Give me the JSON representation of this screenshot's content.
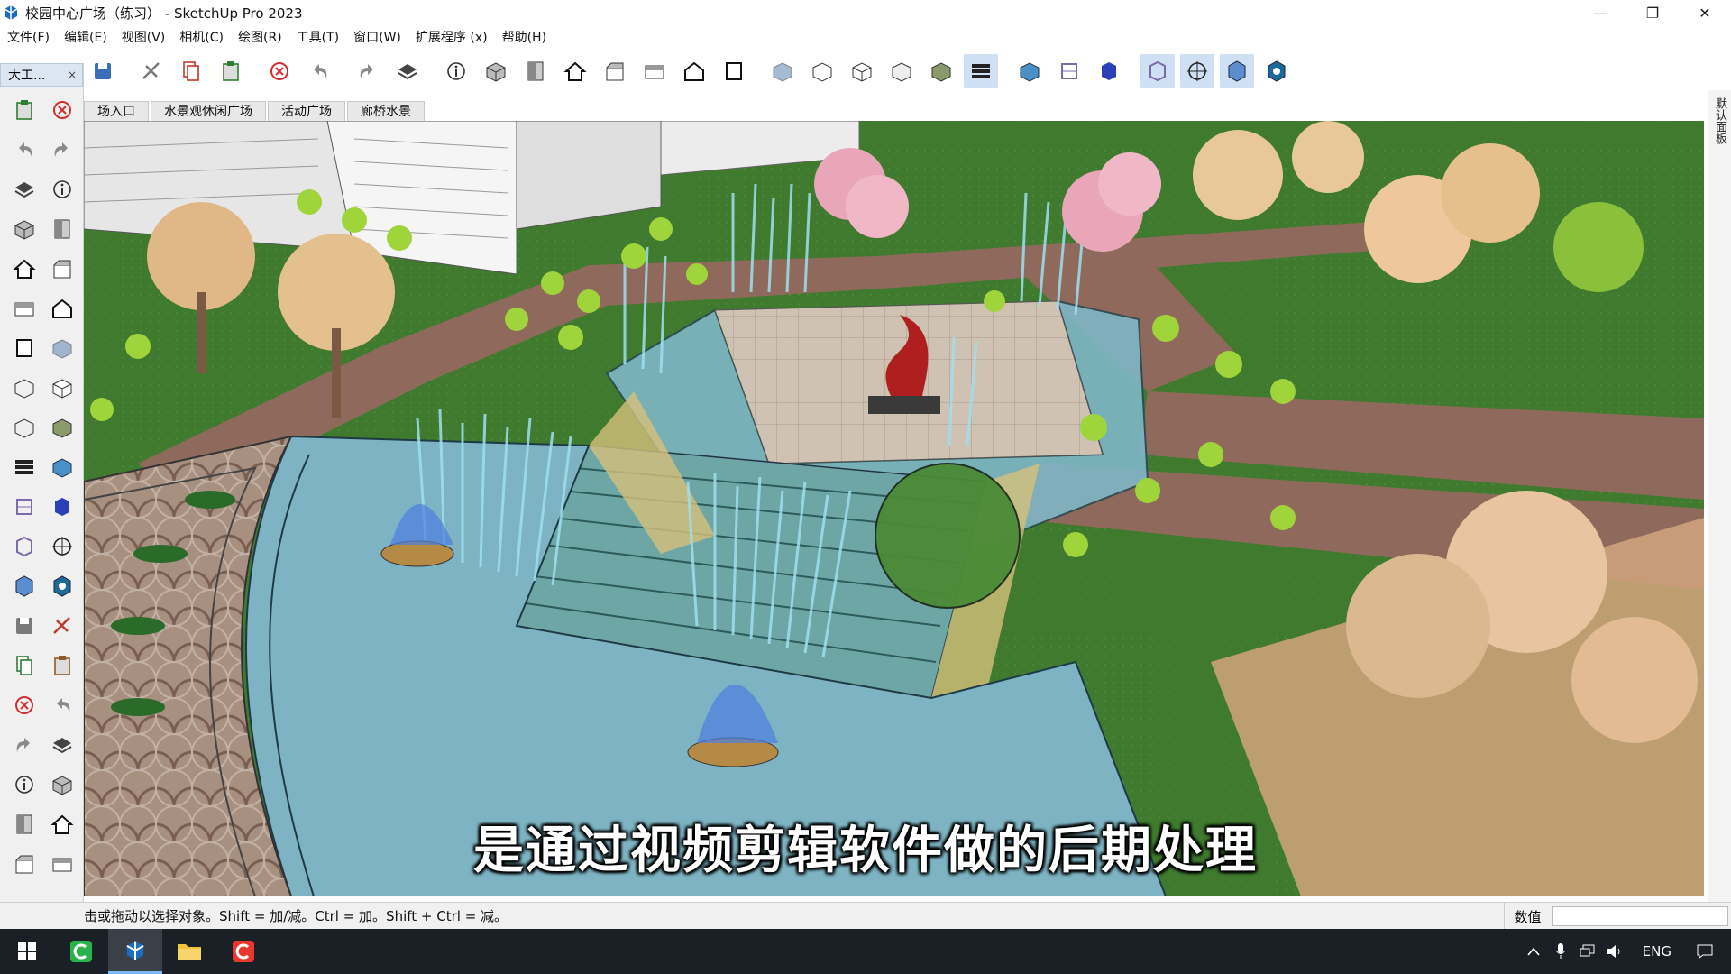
{
  "window": {
    "title": "校园中心广场（练习） - SketchUp Pro 2023",
    "minimize_glyph": "—",
    "maximize_glyph": "❐",
    "close_glyph": "✕"
  },
  "menu": [
    "文件(F)",
    "编辑(E)",
    "视图(V)",
    "相机(C)",
    "绘图(R)",
    "工具(T)",
    "窗口(W)",
    "扩展程序 (x)",
    "帮助(H)"
  ],
  "tool_panel": {
    "title": "大工...",
    "close_glyph": "×"
  },
  "toolbar_icons": [
    "save-icon",
    "cut-icon",
    "copy-icon",
    "paste-icon",
    "erase-icon",
    "undo-icon",
    "redo-icon",
    "print-icon",
    "model-info-icon",
    "iso-view-icon",
    "top-view-icon",
    "home-icon",
    "front-view-icon",
    "right-view-icon",
    "back-view-icon",
    "left-view-icon",
    "xray-icon",
    "wireframe-icon",
    "hidden-line-icon",
    "shaded-icon",
    "shaded-texture-icon",
    "monochrome-icon",
    "section-plane-icon",
    "section-display-icon",
    "section-cut-icon",
    "orbit-view-icon",
    "component-icon",
    "solid-tools-icon",
    "warehouse-icon"
  ],
  "tools": [
    "select-tool-icon",
    "orbit-tool-icon",
    "paint-bucket-icon",
    "eraser-icon",
    "component-icon",
    "pencil-icon",
    "line-tool-icon",
    "freehand-icon",
    "rectangle-icon",
    "rotated-rectangle-icon",
    "circle-icon",
    "polygon-icon",
    "arc-icon",
    "two-point-arc-icon",
    "three-point-arc-icon",
    "pie-icon",
    "move-icon",
    "push-pull-icon",
    "rotate-icon",
    "follow-me-icon",
    "scale-icon",
    "offset-icon",
    "axes-icon",
    "solid-icon",
    "tape-measure-icon",
    "dimension-icon",
    "protractor-icon",
    "text-icon",
    "axes-tool-icon",
    "3d-text-icon",
    "orbit-icon",
    "pan-icon",
    "zoom-icon",
    "zoom-window-icon",
    "zoom-extents-icon",
    "previous-view-icon",
    "position-camera-icon",
    "walk-icon",
    "look-around-icon",
    "section-plane-tool-icon"
  ],
  "scene_tabs": [
    "场入口",
    "水景观休闲广场",
    "活动广场",
    "廊桥水景"
  ],
  "right_tray_label": "默认面板",
  "subtitle": "是通过视频剪辑软件做的后期处理",
  "status": {
    "hint": "击或拖动以选择对象。Shift = 加/减。Ctrl = 加。Shift + Ctrl = 减。",
    "measure_label": "数值"
  },
  "taskbar": {
    "lang": "ENG"
  },
  "colors": {
    "grass": "#3f7a2e",
    "water": "#7fb6c6",
    "paving": "#b9a394",
    "path": "#8f6a5c",
    "tree_green": "#9fd43a",
    "blossom": "#e8a6b8",
    "titlebar_bg": "#ffffff",
    "taskbar_bg": "#1b1f26"
  }
}
